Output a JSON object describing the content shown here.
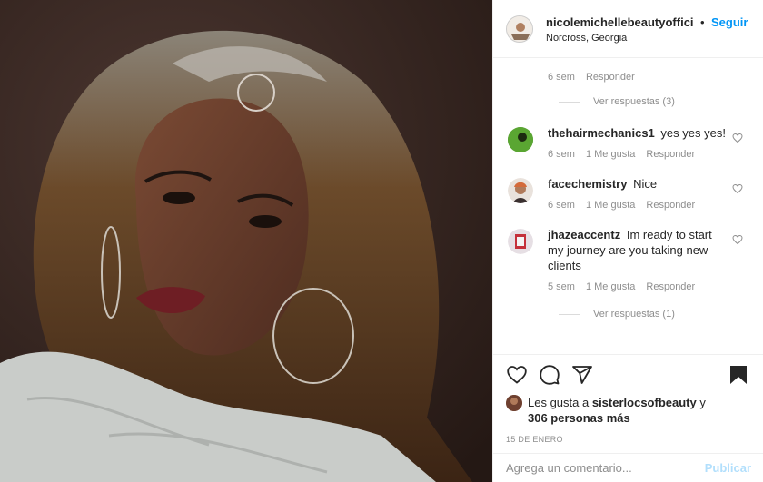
{
  "post": {
    "username": "nicolemichellebeautyoffici",
    "follow_label": "Seguir",
    "location": "Norcross, Georgia",
    "separator": "•"
  },
  "top_comment_meta": {
    "time": "6 sem",
    "reply_label": "Responder",
    "view_replies": "Ver respuestas (3)"
  },
  "comments": [
    {
      "username": "thehairmechanics1",
      "text": "yes yes yes!",
      "time": "6 sem",
      "likes": "1 Me gusta",
      "reply_label": "Responder",
      "avatar_color": "#4a8f2a"
    },
    {
      "username": "facechemistry",
      "text": "Nice",
      "time": "6 sem",
      "likes": "1 Me gusta",
      "reply_label": "Responder",
      "avatar_color": "#c9a48c"
    },
    {
      "username": "jhazeaccentz",
      "text": "Im ready to start my journey are you taking new clients",
      "time": "5 sem",
      "likes": "1 Me gusta",
      "reply_label": "Responder",
      "view_replies": "Ver respuestas (1)",
      "avatar_color": "#d9d0d6"
    }
  ],
  "likes_summary": {
    "prefix": "Les gusta a",
    "user": "sisterlocsofbeauty",
    "conjunction": "y",
    "others": "306 personas más"
  },
  "date": "15 DE ENERO",
  "add_comment": {
    "placeholder": "Agrega un comentario...",
    "publish_label": "Publicar"
  },
  "colors": {
    "link_blue": "#0095f6",
    "publish_disabled": "#b2dffc",
    "muted": "#8e8e8e"
  },
  "icons": [
    "heart-icon",
    "comment-icon",
    "share-icon",
    "bookmark-icon"
  ]
}
